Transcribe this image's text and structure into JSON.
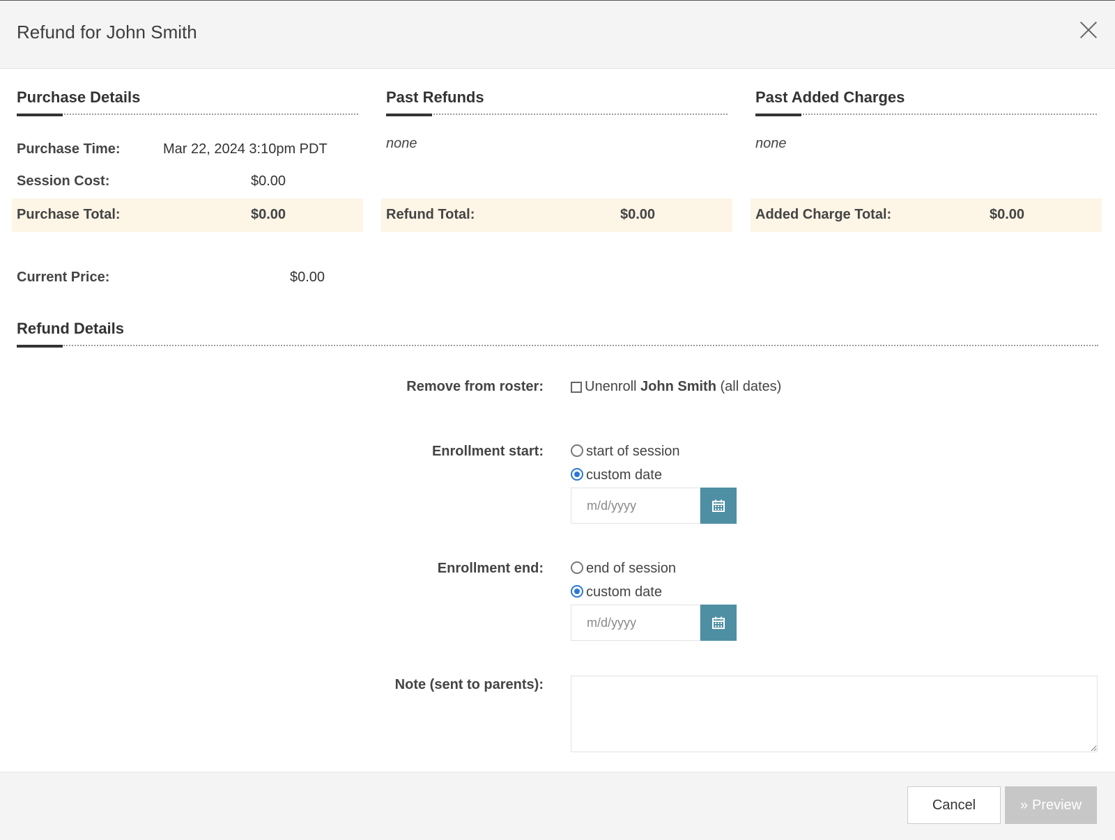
{
  "header": {
    "title": "Refund for John Smith"
  },
  "purchase": {
    "heading": "Purchase Details",
    "time_label": "Purchase Time:",
    "time_value": "Mar 22, 2024 3:10pm PDT",
    "cost_label": "Session Cost:",
    "cost_value": "$0.00",
    "total_label": "Purchase Total:",
    "total_value": "$0.00",
    "current_label": "Current Price:",
    "current_value": "$0.00"
  },
  "refunds": {
    "heading": "Past Refunds",
    "empty_text": "none",
    "total_label": "Refund Total:",
    "total_value": "$0.00"
  },
  "charges": {
    "heading": "Past Added Charges",
    "empty_text": "none",
    "total_label": "Added Charge Total:",
    "total_value": "$0.00"
  },
  "refund_details": {
    "heading": "Refund Details",
    "roster_label": "Remove from roster:",
    "unenroll_prefix": "Unenroll",
    "unenroll_name": "John Smith",
    "unenroll_suffix": "(all dates)",
    "unenroll_checked": false,
    "start_label": "Enrollment start:",
    "start_opt1": "start of session",
    "start_opt2": "custom date",
    "start_selected": "custom date",
    "start_placeholder": "m/d/yyyy",
    "end_label": "Enrollment end:",
    "end_opt1": "end of session",
    "end_opt2": "custom date",
    "end_selected": "custom date",
    "end_placeholder": "m/d/yyyy",
    "note_label": "Note (sent to parents):",
    "note_value": ""
  },
  "footer": {
    "cancel_label": "Cancel",
    "preview_label": "Preview"
  },
  "colors": {
    "accent": "#4f8fa4",
    "total_band": "#fdf5e6",
    "radio_selected": "#2a77d6",
    "disabled_button": "#c7c7c7"
  },
  "icons": {
    "close": "close-icon",
    "calendar": "calendar-icon",
    "preview": "double-chevron-right-icon"
  }
}
